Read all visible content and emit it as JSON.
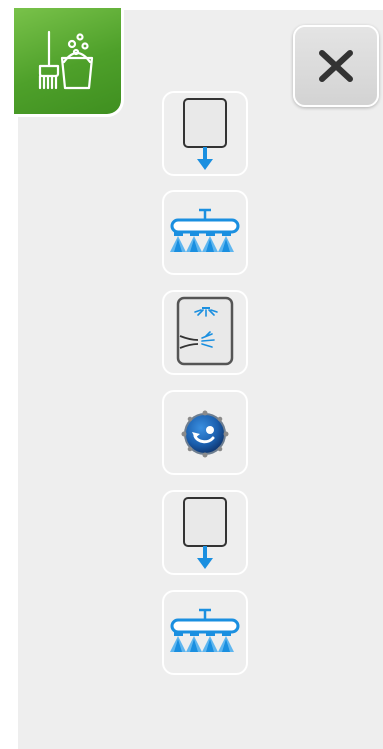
{
  "app": {
    "mode_icon": "cleaning-bucket-broom-icon",
    "accent_color": "#5aaa30"
  },
  "header": {
    "close_icon": "close-x-icon"
  },
  "program_steps": [
    {
      "id": "drain",
      "icon": "tank-drain-arrow-icon"
    },
    {
      "id": "rinse",
      "icon": "spray-arm-rinse-icon"
    },
    {
      "id": "wash",
      "icon": "chamber-wash-jets-icon"
    },
    {
      "id": "pump",
      "icon": "circulation-pump-icon"
    },
    {
      "id": "drain",
      "icon": "tank-drain-arrow-icon"
    },
    {
      "id": "rinse",
      "icon": "spray-arm-rinse-icon"
    }
  ],
  "colors": {
    "water_blue": "#1a8fe0",
    "panel_bg": "#eeeeee",
    "button_gray": "#d8d8d8"
  }
}
